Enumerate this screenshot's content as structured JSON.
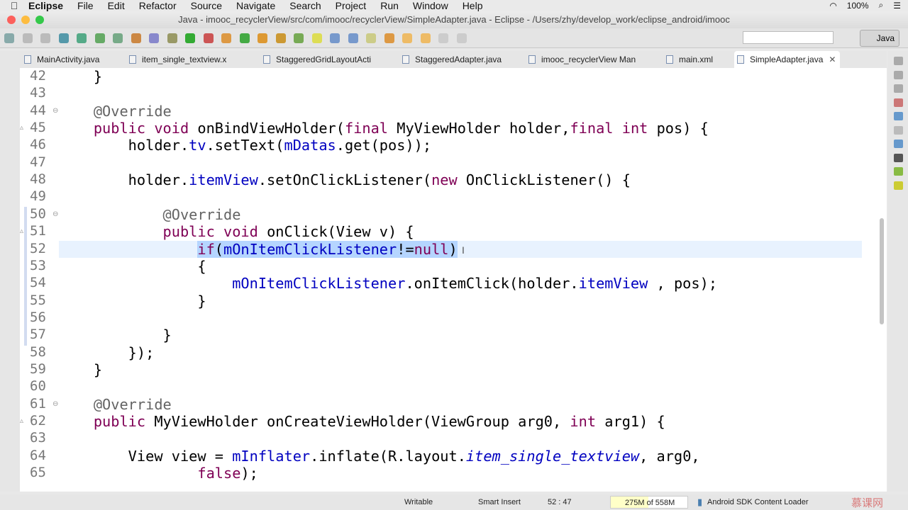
{
  "menubar": {
    "app": "Eclipse",
    "items": [
      "File",
      "Edit",
      "Refactor",
      "Source",
      "Navigate",
      "Search",
      "Project",
      "Run",
      "Window",
      "Help"
    ],
    "battery": "100%"
  },
  "window": {
    "title": "Java - imooc_recyclerView/src/com/imooc/recyclerView/SimpleAdapter.java - Eclipse - /Users/zhy/develop_work/eclipse_android/imooc"
  },
  "toolbar": {
    "perspective": "Java",
    "quick_access_placeholder": ""
  },
  "tabs": [
    "MainActivity.java",
    "item_single_textview.x",
    "StaggeredGridLayoutActi",
    "StaggeredAdapter.java",
    "imooc_recyclerView Man",
    "main.xml",
    "SimpleAdapter.java"
  ],
  "editor": {
    "lines": [
      {
        "n": "42",
        "t": [
          [
            "    }",
            ""
          ]
        ]
      },
      {
        "n": "43",
        "t": []
      },
      {
        "n": "44",
        "t": [
          [
            "    @Override",
            "an"
          ]
        ]
      },
      {
        "n": "45",
        "t": [
          [
            "    ",
            ""
          ],
          [
            "public",
            "kw"
          ],
          [
            " ",
            ""
          ],
          [
            "void",
            "kw"
          ],
          [
            " onBindViewHolder(",
            ""
          ],
          [
            "final",
            "kw"
          ],
          [
            " MyViewHolder holder,",
            ""
          ],
          [
            "final",
            "kw"
          ],
          [
            " ",
            ""
          ],
          [
            "int",
            "kw"
          ],
          [
            " pos) {",
            ""
          ]
        ]
      },
      {
        "n": "46",
        "t": [
          [
            "        holder.",
            ""
          ],
          [
            "tv",
            "fd"
          ],
          [
            ".setText(",
            ""
          ],
          [
            "mDatas",
            "fd"
          ],
          [
            ".get(pos));",
            ""
          ]
        ]
      },
      {
        "n": "47",
        "t": []
      },
      {
        "n": "48",
        "t": [
          [
            "        holder.",
            ""
          ],
          [
            "itemView",
            "fd"
          ],
          [
            ".setOnClickListener(",
            ""
          ],
          [
            "new",
            "kw"
          ],
          [
            " OnClickListener() {",
            ""
          ]
        ]
      },
      {
        "n": "49",
        "t": []
      },
      {
        "n": "50",
        "t": [
          [
            "            @Override",
            "an"
          ]
        ]
      },
      {
        "n": "51",
        "t": [
          [
            "            ",
            ""
          ],
          [
            "public",
            "kw"
          ],
          [
            " ",
            ""
          ],
          [
            "void",
            "kw"
          ],
          [
            " onClick(View v) {",
            ""
          ]
        ]
      },
      {
        "n": "52",
        "t": [
          [
            "                ",
            ""
          ],
          [
            "if",
            "kw sel"
          ],
          [
            "(",
            "sel"
          ],
          [
            "mOnItemClickListener",
            "fd sel"
          ],
          [
            "!=",
            "sel"
          ],
          [
            "null",
            "kw sel"
          ],
          [
            ")",
            "sel"
          ]
        ]
      },
      {
        "n": "53",
        "t": [
          [
            "                {",
            ""
          ]
        ]
      },
      {
        "n": "54",
        "t": [
          [
            "                    ",
            ""
          ],
          [
            "mOnItemClickListener",
            "fd"
          ],
          [
            ".onItemClick(holder.",
            ""
          ],
          [
            "itemView",
            "fd"
          ],
          [
            " , pos);",
            ""
          ]
        ]
      },
      {
        "n": "55",
        "t": [
          [
            "                }",
            ""
          ]
        ]
      },
      {
        "n": "56",
        "t": []
      },
      {
        "n": "57",
        "t": [
          [
            "            }",
            ""
          ]
        ]
      },
      {
        "n": "58",
        "t": [
          [
            "        });",
            ""
          ]
        ]
      },
      {
        "n": "59",
        "t": [
          [
            "    }",
            ""
          ]
        ]
      },
      {
        "n": "60",
        "t": []
      },
      {
        "n": "61",
        "t": [
          [
            "    @Override",
            "an"
          ]
        ]
      },
      {
        "n": "62",
        "t": [
          [
            "    ",
            ""
          ],
          [
            "public",
            "kw"
          ],
          [
            " MyViewHolder onCreateViewHolder(ViewGroup arg0, ",
            ""
          ],
          [
            "int",
            "kw"
          ],
          [
            " arg1) {",
            ""
          ]
        ]
      },
      {
        "n": "63",
        "t": []
      },
      {
        "n": "64",
        "t": [
          [
            "        View view = ",
            ""
          ],
          [
            "mInflater",
            "fd"
          ],
          [
            ".inflate(R.layout.",
            ""
          ],
          [
            "item_single_textview",
            "sf"
          ],
          [
            ", arg0,",
            ""
          ]
        ]
      },
      {
        "n": "65",
        "t": [
          [
            "                ",
            ""
          ],
          [
            "false",
            "kw"
          ],
          [
            ");",
            ""
          ]
        ]
      }
    ]
  },
  "status": {
    "mode": "Writable",
    "insert": "Smart Insert",
    "position": "52 : 47",
    "memory": "275M of 558M",
    "memory_used_fraction": 0.49,
    "task": "Android SDK Content Loader"
  },
  "watermark": "慕课网"
}
